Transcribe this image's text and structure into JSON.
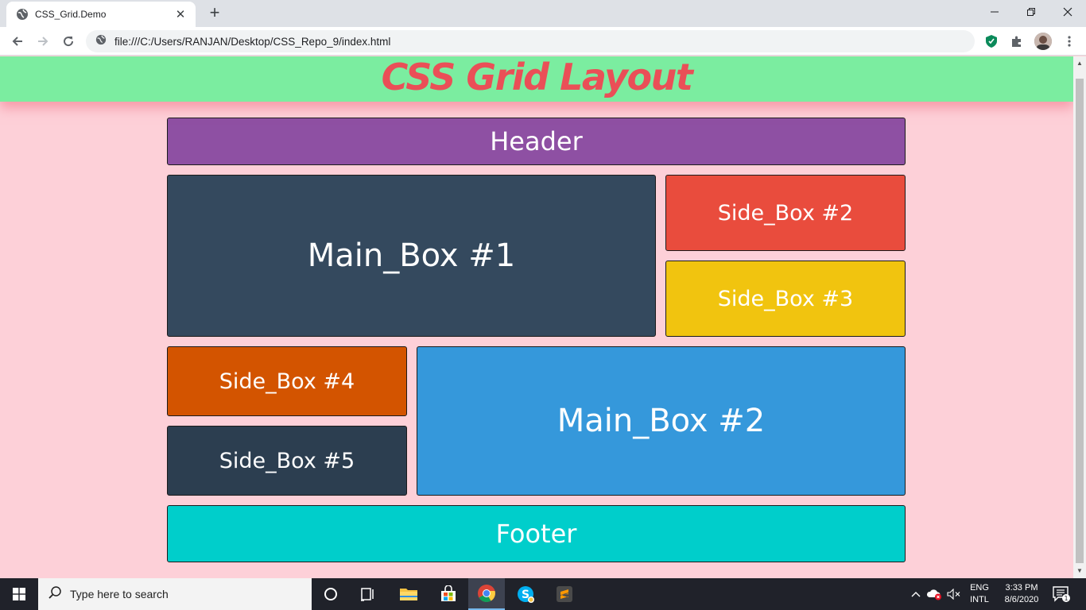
{
  "browser": {
    "tab_title": "CSS_Grid.Demo",
    "tab_close": "✕",
    "new_tab": "+",
    "url": "file:///C:/Users/RANJAN/Desktop/CSS_Repo_9/index.html",
    "window_controls": {
      "minimize": "—",
      "restore": "❐",
      "close": "✕"
    }
  },
  "page": {
    "title": "CSS Grid Layout",
    "boxes": {
      "header": "Header",
      "main1": "Main_Box #1",
      "side2": "Side_Box #2",
      "side3": "Side_Box #3",
      "side4": "Side_Box #4",
      "main2": "Main_Box #2",
      "side5": "Side_Box #5",
      "footer": "Footer"
    },
    "colors": {
      "background": "#fdd0d8",
      "banner": "#7beda0",
      "title": "#ea4f57",
      "header": "#8e50a3",
      "main1": "#34495e",
      "side2": "#e94c3d",
      "side3": "#f1c40f",
      "side4": "#d35400",
      "main2": "#3598db",
      "side5": "#2c3e50",
      "footer": "#00cecb"
    }
  },
  "taskbar": {
    "search_placeholder": "Type here to search",
    "apps": [
      "cortana-icon",
      "task-view-icon",
      "file-explorer-icon",
      "store-icon",
      "chrome-icon",
      "skype-icon",
      "sublime-text-icon"
    ],
    "lang_primary": "ENG",
    "lang_secondary": "INTL",
    "time": "3:33 PM",
    "date": "8/6/2020",
    "notification_count": "1"
  }
}
